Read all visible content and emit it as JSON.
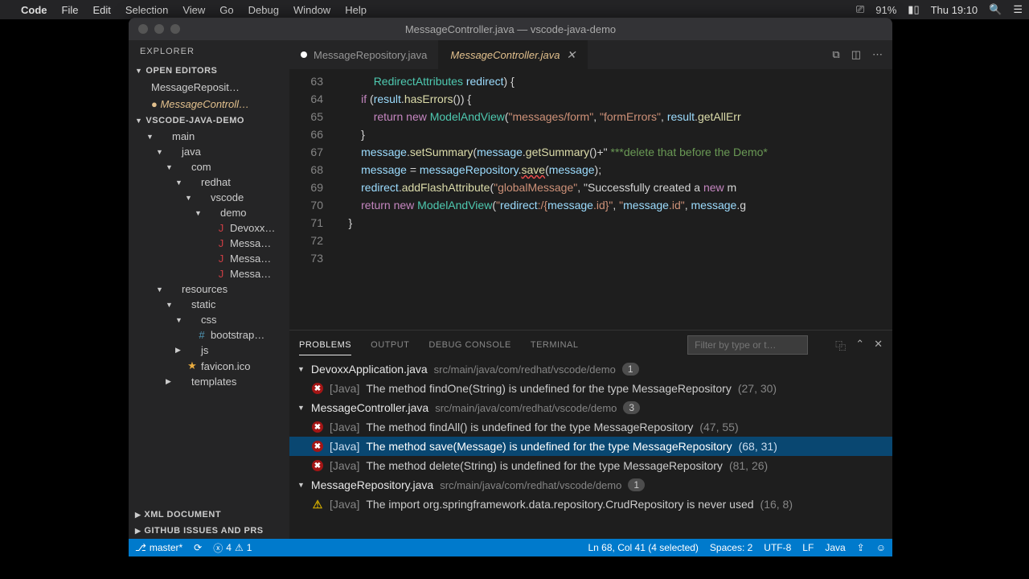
{
  "menubar": {
    "app": "Code",
    "items": [
      "File",
      "Edit",
      "Selection",
      "View",
      "Go",
      "Debug",
      "Window",
      "Help"
    ],
    "battery": "91%",
    "clock": "Thu 19:10"
  },
  "window": {
    "title": "MessageController.java — vscode-java-demo"
  },
  "sidebar": {
    "title": "EXPLORER",
    "open_editors_label": "OPEN EDITORS",
    "open_editors": [
      {
        "label": "MessageReposit…",
        "modified": false
      },
      {
        "label": "MessageControll…",
        "modified": true
      }
    ],
    "project": "VSCODE-JAVA-DEMO",
    "tree": [
      {
        "d": 1,
        "t": "folder",
        "l": "main",
        "open": true
      },
      {
        "d": 2,
        "t": "folder",
        "l": "java",
        "open": true
      },
      {
        "d": 3,
        "t": "folder",
        "l": "com",
        "open": true
      },
      {
        "d": 4,
        "t": "folder",
        "l": "redhat",
        "open": true
      },
      {
        "d": 5,
        "t": "folder",
        "l": "vscode",
        "open": true
      },
      {
        "d": 6,
        "t": "folder",
        "l": "demo",
        "open": true
      },
      {
        "d": 7,
        "t": "file",
        "l": "Devoxx…",
        "ic": "J"
      },
      {
        "d": 7,
        "t": "file",
        "l": "Messa…",
        "ic": "J"
      },
      {
        "d": 7,
        "t": "file",
        "l": "Messa…",
        "ic": "J"
      },
      {
        "d": 7,
        "t": "file",
        "l": "Messa…",
        "ic": "J"
      },
      {
        "d": 2,
        "t": "folder",
        "l": "resources",
        "open": true
      },
      {
        "d": 3,
        "t": "folder",
        "l": "static",
        "open": true
      },
      {
        "d": 4,
        "t": "folder",
        "l": "css",
        "open": true
      },
      {
        "d": 5,
        "t": "file",
        "l": "bootstrap…",
        "ic": "#"
      },
      {
        "d": 4,
        "t": "folder",
        "l": "js",
        "open": false
      },
      {
        "d": 4,
        "t": "file",
        "l": "favicon.ico",
        "ic": "★"
      },
      {
        "d": 3,
        "t": "folder",
        "l": "templates",
        "open": false
      }
    ],
    "footers": [
      "XML DOCUMENT",
      "GITHUB ISSUES AND PRS"
    ]
  },
  "tabs": [
    {
      "label": "MessageRepository.java",
      "active": false,
      "dirty": true
    },
    {
      "label": "MessageController.java",
      "active": true,
      "dirty": true
    }
  ],
  "code": {
    "start": 63,
    "lines": [
      "            RedirectAttributes redirect) {",
      "        if (result.hasErrors()) {",
      "            return new ModelAndView(\"messages/form\", \"formErrors\", result.getAllErr",
      "        }",
      "        message.setSummary(message.getSummary()+\" ***delete that before the Demo*",
      "        message = messageRepository.save(message);",
      "",
      "        redirect.addFlashAttribute(\"globalMessage\", \"Successfully created a new m",
      "        return new ModelAndView(\"redirect:/{message.id}\", \"message.id\", message.g",
      "    }",
      ""
    ]
  },
  "panel": {
    "tabs": [
      "PROBLEMS",
      "OUTPUT",
      "DEBUG CONSOLE",
      "TERMINAL"
    ],
    "filter_placeholder": "Filter by type or t…",
    "groups": [
      {
        "file": "DevoxxApplication.java",
        "path": "src/main/java/com/redhat/vscode/demo",
        "count": 1,
        "items": [
          {
            "sev": "err",
            "tag": "[Java]",
            "msg": "The method findOne(String) is undefined for the type MessageRepository",
            "loc": "(27, 30)"
          }
        ]
      },
      {
        "file": "MessageController.java",
        "path": "src/main/java/com/redhat/vscode/demo",
        "count": 3,
        "items": [
          {
            "sev": "err",
            "tag": "[Java]",
            "msg": "The method findAll() is undefined for the type MessageRepository",
            "loc": "(47, 55)"
          },
          {
            "sev": "err",
            "tag": "[Java]",
            "msg": "The method save(Message) is undefined for the type MessageRepository",
            "loc": "(68, 31)",
            "sel": true
          },
          {
            "sev": "err",
            "tag": "[Java]",
            "msg": "The method delete(String) is undefined for the type MessageRepository",
            "loc": "(81, 26)"
          }
        ]
      },
      {
        "file": "MessageRepository.java",
        "path": "src/main/java/com/redhat/vscode/demo",
        "count": 1,
        "items": [
          {
            "sev": "warn",
            "tag": "[Java]",
            "msg": "The import org.springframework.data.repository.CrudRepository is never used",
            "loc": "(16, 8)"
          }
        ]
      }
    ]
  },
  "statusbar": {
    "branch": "master*",
    "errors": "4",
    "warnings": "1",
    "cursor": "Ln 68, Col 41 (4 selected)",
    "spaces": "Spaces: 2",
    "encoding": "UTF-8",
    "eol": "LF",
    "lang": "Java"
  }
}
